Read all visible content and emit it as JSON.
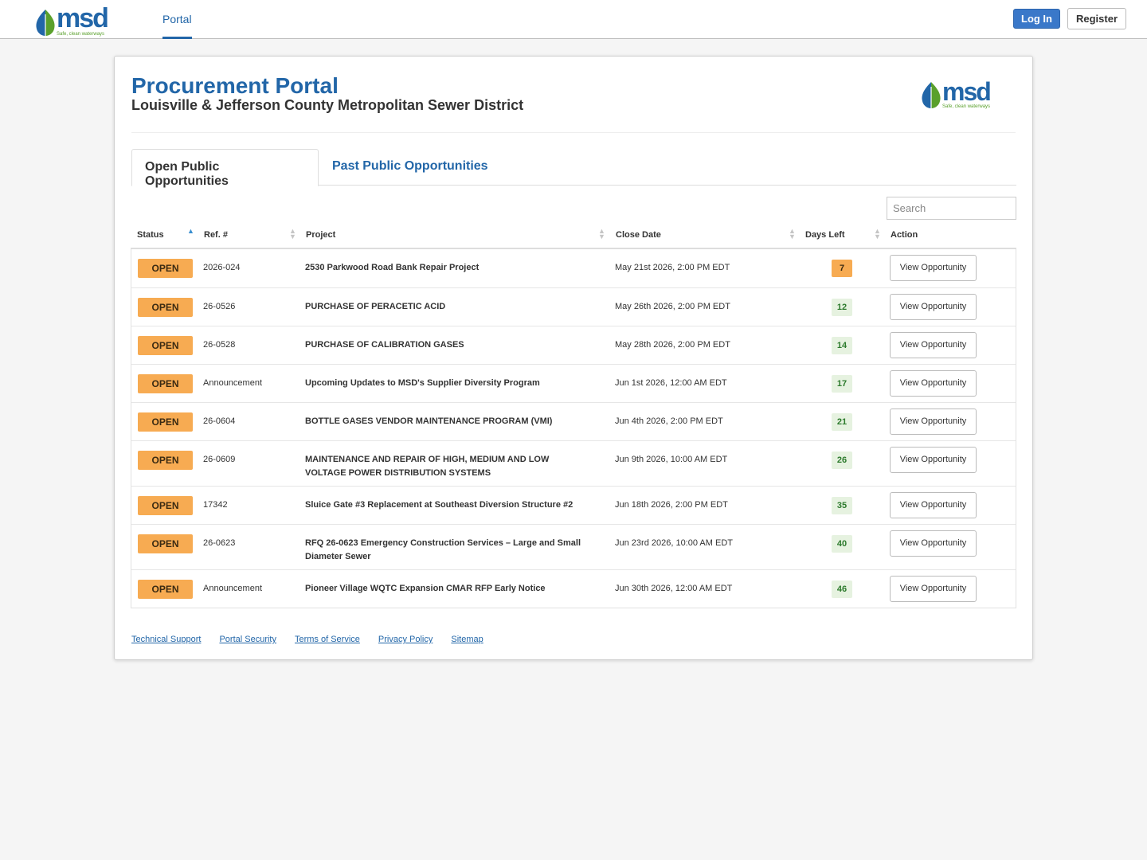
{
  "header": {
    "logo_text": "msd",
    "logo_tagline": "Safe, clean waterways",
    "nav_tab": "Portal",
    "login_label": "Log In",
    "register_label": "Register"
  },
  "page": {
    "title": "Procurement Portal",
    "subtitle": "Louisville & Jefferson County Metropolitan Sewer District"
  },
  "tabs": {
    "open": "Open Public Opportunities",
    "past": "Past Public Opportunities"
  },
  "search": {
    "placeholder": "Search"
  },
  "table": {
    "columns": {
      "status": "Status",
      "ref": "Ref. #",
      "project": "Project",
      "close_date": "Close Date",
      "days_left": "Days Left",
      "action": "Action"
    },
    "rows": [
      {
        "status": "OPEN",
        "ref": "2026-024",
        "project": "2530 Parkwood Road Bank Repair Project",
        "close_date": "May 21st 2026, 2:00 PM EDT",
        "days": "7",
        "days_color": "orange",
        "action": "View Opportunity"
      },
      {
        "status": "OPEN",
        "ref": "26-0526",
        "project": "PURCHASE OF PERACETIC ACID",
        "close_date": "May 26th 2026, 2:00 PM EDT",
        "days": "12",
        "days_color": "green",
        "action": "View Opportunity"
      },
      {
        "status": "OPEN",
        "ref": "26-0528",
        "project": "PURCHASE OF CALIBRATION GASES",
        "close_date": "May 28th 2026, 2:00 PM EDT",
        "days": "14",
        "days_color": "green",
        "action": "View Opportunity"
      },
      {
        "status": "OPEN",
        "ref": "Announcement",
        "project": "Upcoming Updates to MSD's Supplier Diversity Program",
        "close_date": "Jun 1st 2026, 12:00 AM EDT",
        "days": "17",
        "days_color": "green",
        "action": "View Opportunity"
      },
      {
        "status": "OPEN",
        "ref": "26-0604",
        "project": "BOTTLE GASES VENDOR MAINTENANCE PROGRAM (VMI)",
        "close_date": "Jun 4th 2026, 2:00 PM EDT",
        "days": "21",
        "days_color": "green",
        "action": "View Opportunity"
      },
      {
        "status": "OPEN",
        "ref": "26-0609",
        "project": "MAINTENANCE AND REPAIR OF HIGH, MEDIUM AND LOW VOLTAGE POWER DISTRIBUTION SYSTEMS",
        "close_date": "Jun 9th 2026, 10:00 AM EDT",
        "days": "26",
        "days_color": "green",
        "action": "View Opportunity"
      },
      {
        "status": "OPEN",
        "ref": "17342",
        "project": "Sluice Gate #3 Replacement at Southeast Diversion Structure #2",
        "close_date": "Jun 18th 2026, 2:00 PM EDT",
        "days": "35",
        "days_color": "green",
        "action": "View Opportunity"
      },
      {
        "status": "OPEN",
        "ref": "26-0623",
        "project": "RFQ 26-0623 Emergency Construction Services – Large and Small Diameter Sewer",
        "close_date": "Jun 23rd 2026, 10:00 AM EDT",
        "days": "40",
        "days_color": "green",
        "action": "View Opportunity"
      },
      {
        "status": "OPEN",
        "ref": "Announcement",
        "project": "Pioneer Village WQTC Expansion CMAR RFP Early Notice",
        "close_date": "Jun 30th 2026, 12:00 AM EDT",
        "days": "46",
        "days_color": "green",
        "action": "View Opportunity"
      }
    ]
  },
  "footer": {
    "links": [
      "Technical Support",
      "Portal Security",
      "Terms of Service",
      "Privacy Policy",
      "Sitemap"
    ]
  },
  "colors": {
    "brand_blue": "#2266a8",
    "brand_green": "#5aa02c",
    "open_badge": "#f7ab52",
    "days_green_bg": "#e6f2e0",
    "login_blue": "#3a78c9"
  }
}
